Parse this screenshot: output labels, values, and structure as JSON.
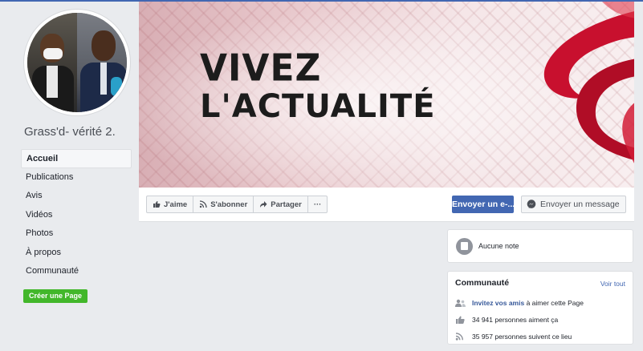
{
  "page": {
    "name": "Grass'd- vérité 2."
  },
  "nav": {
    "items": [
      {
        "label": "Accueil",
        "active": true
      },
      {
        "label": "Publications"
      },
      {
        "label": "Avis"
      },
      {
        "label": "Vidéos"
      },
      {
        "label": "Photos"
      },
      {
        "label": "À propos"
      },
      {
        "label": "Communauté"
      }
    ],
    "create_page": "Créer une Page"
  },
  "cover": {
    "line1": "VIVEZ",
    "line2": "L'ACTUALITÉ"
  },
  "actions": {
    "like": "J'aime",
    "follow": "S'abonner",
    "share": "Partager",
    "more": "···",
    "email": "Envoyer un e-...",
    "message": "Envoyer un message"
  },
  "notes": {
    "text": "Aucune note"
  },
  "community": {
    "title": "Communauté",
    "see_all": "Voir tout",
    "invite_link": "Invitez vos amis",
    "invite_rest": "à aimer cette Page",
    "likes": "34 941 personnes aiment ça",
    "follows": "35 957 personnes suivent ce lieu"
  },
  "colors": {
    "brand_blue": "#4267b2",
    "create_green": "#42b72a",
    "background": "#e9ebee"
  }
}
